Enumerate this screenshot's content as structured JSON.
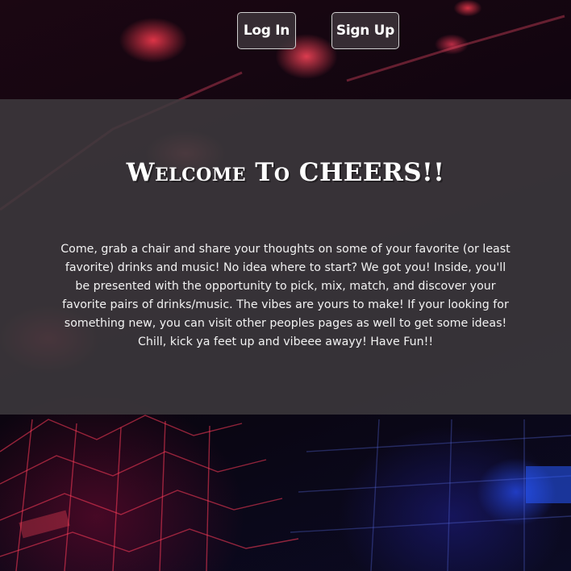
{
  "nav": {
    "login_label": "Log In",
    "signup_label": "Sign Up"
  },
  "hero": {
    "title": "Welcome To CHEERS!!",
    "text": "Come, grab a chair and share your thoughts on some of your favorite (or least favorite) drinks and music! No idea where to start? We got you! Inside, you'll be presented with the opportunity to pick, mix, match, and discover your favorite pairs of drinks/music. The vibes are yours to make! If your looking for something new, you can visit other peoples pages as well to get some ideas! Chill, kick ya feet up and vibeee awayy! Have Fun!!"
  },
  "colors": {
    "overlay": "#3e3a3e",
    "text": "#ffffff",
    "background_red": "#ff3c50",
    "background_blue": "#2850ff"
  }
}
